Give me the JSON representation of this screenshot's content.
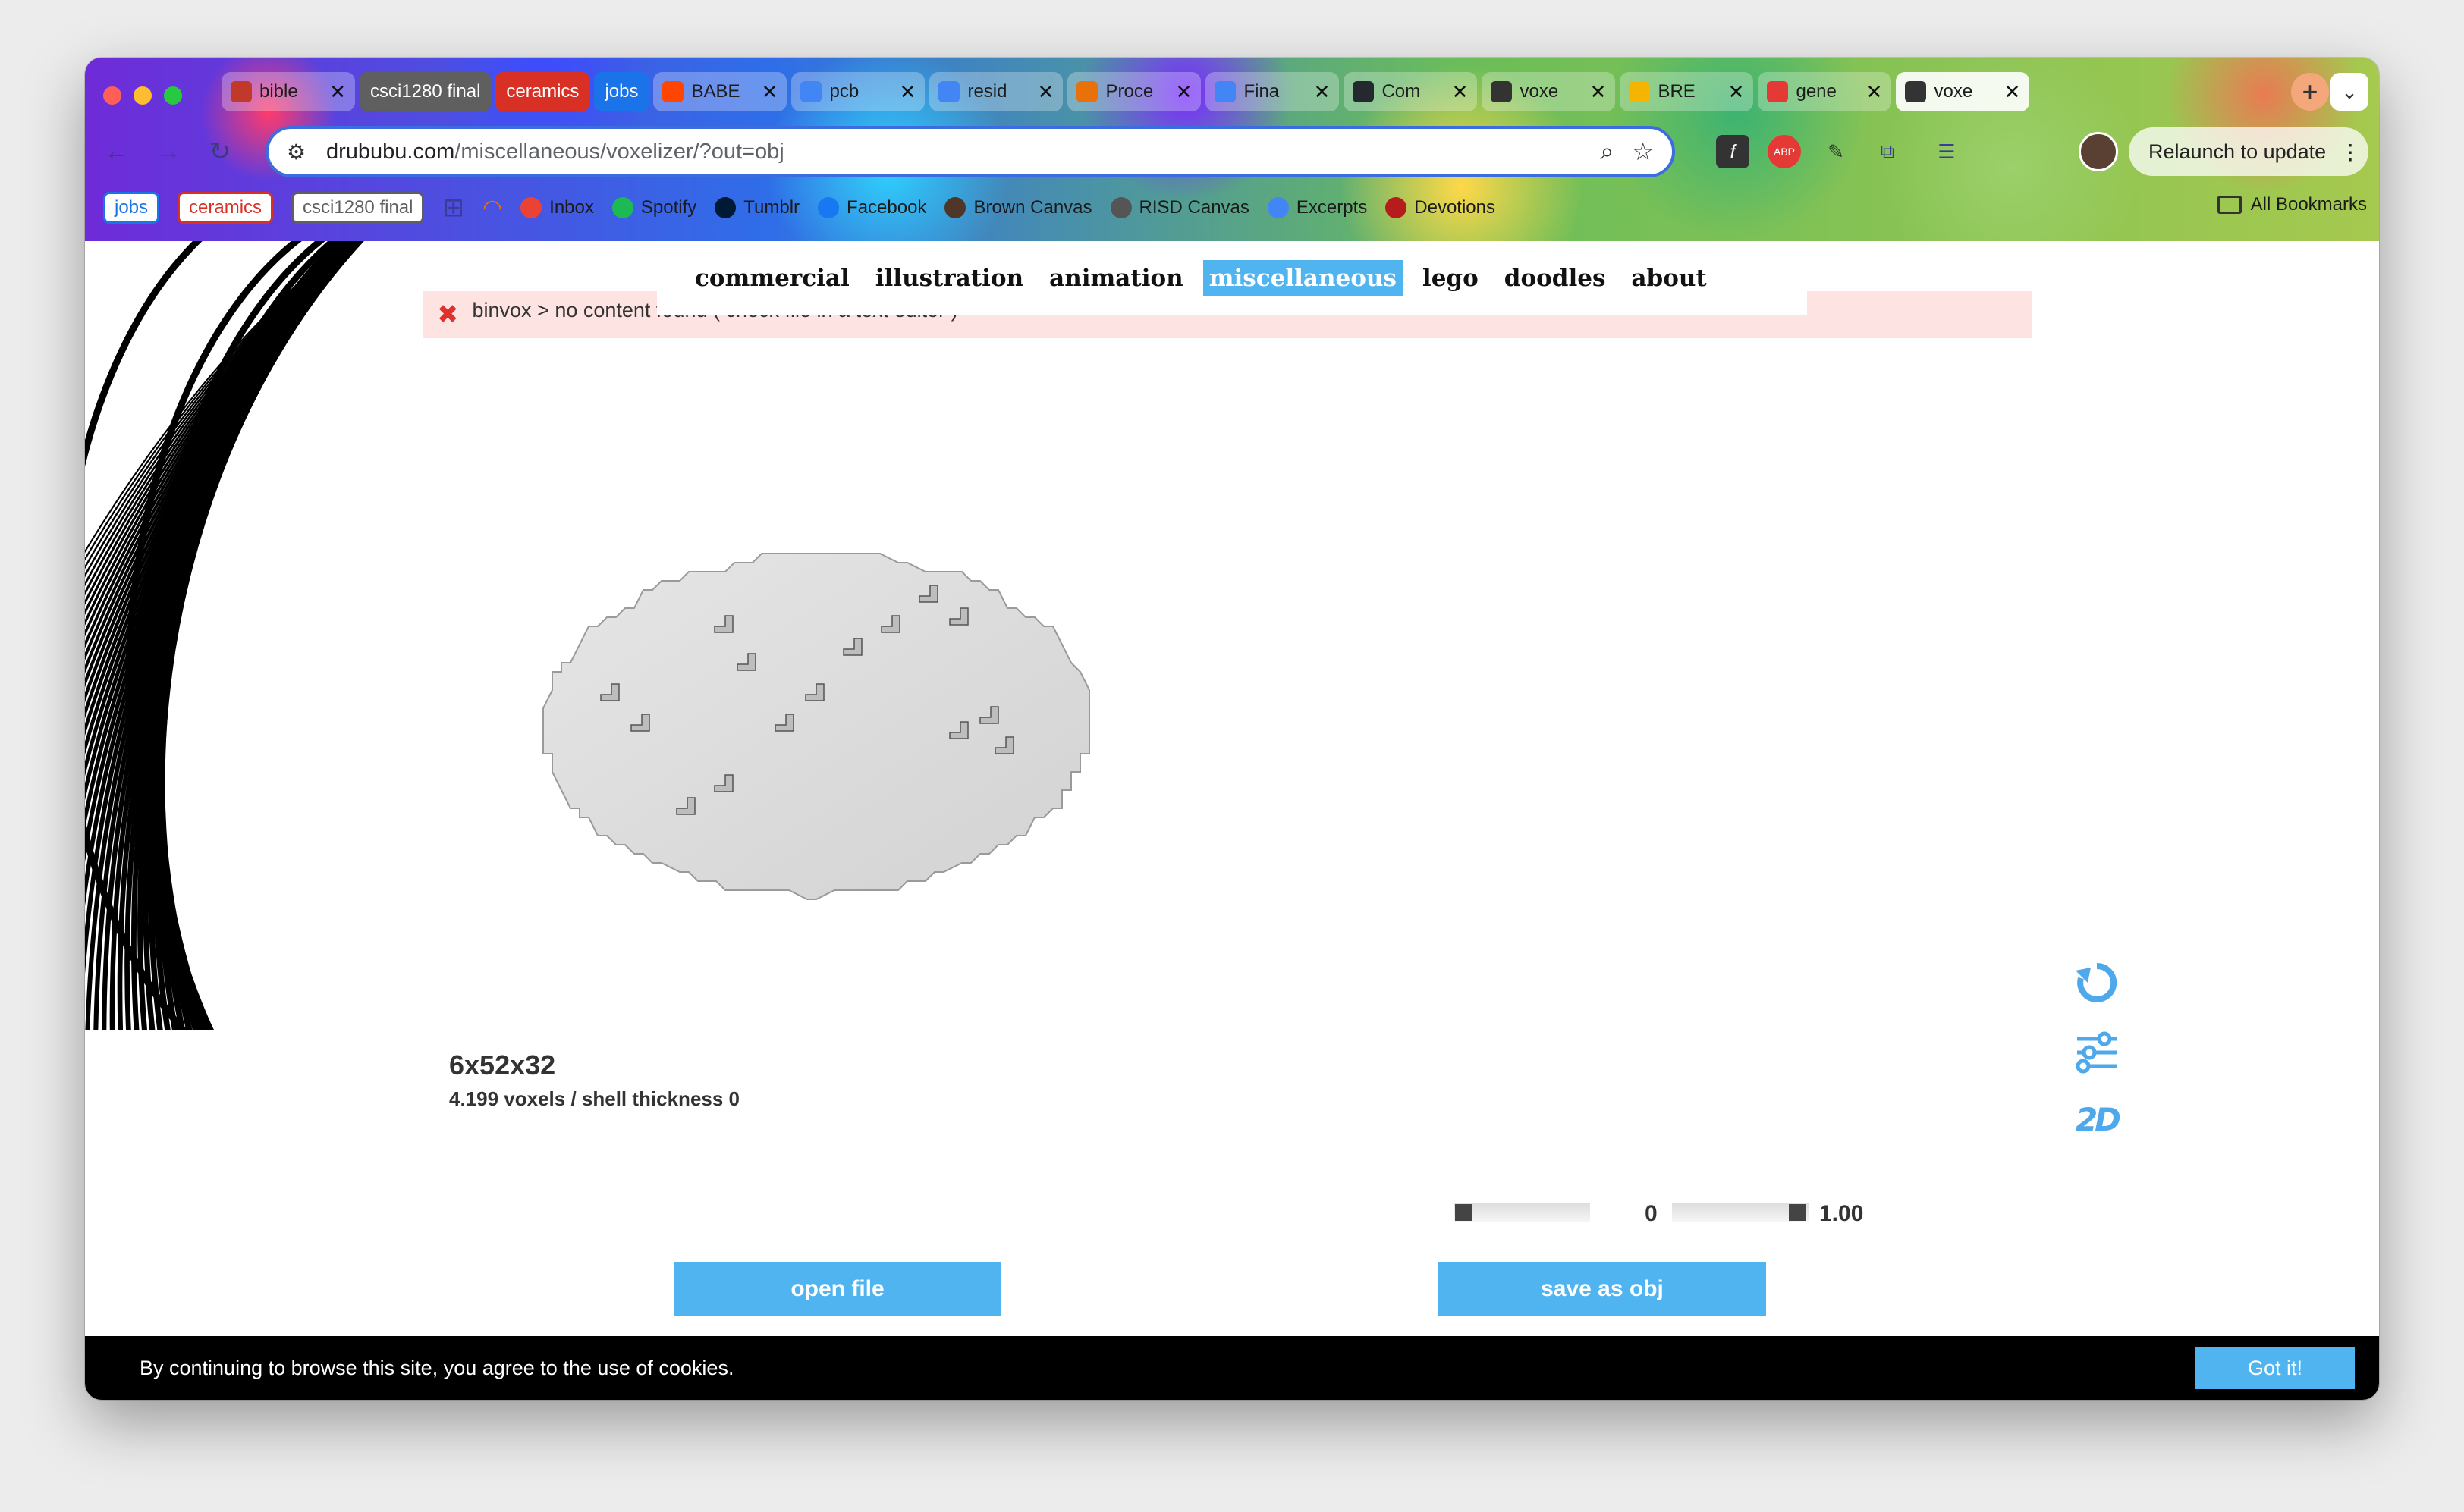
{
  "tabs": [
    {
      "title": "bible",
      "favicon_color": "#c0392b",
      "kind": "tab"
    },
    {
      "title": "csci1280 final",
      "kind": "group",
      "color": "#5f5f5f"
    },
    {
      "title": "ceramics",
      "kind": "group",
      "color": "#d93025"
    },
    {
      "title": "jobs",
      "kind": "group",
      "color": "#1a73e8"
    },
    {
      "title": "BABE",
      "favicon_color": "#ff4500",
      "kind": "tab"
    },
    {
      "title": "pcb",
      "favicon_color": "#4285f4",
      "kind": "tab"
    },
    {
      "title": "resid",
      "favicon_color": "#4285f4",
      "kind": "tab"
    },
    {
      "title": "Proce",
      "favicon_color": "#e8710a",
      "kind": "tab"
    },
    {
      "title": "Fina",
      "favicon_color": "#4285f4",
      "kind": "tab"
    },
    {
      "title": "Com",
      "favicon_color": "#24292f",
      "kind": "tab"
    },
    {
      "title": "voxe",
      "favicon_color": "#333333",
      "kind": "tab"
    },
    {
      "title": "BRE",
      "favicon_color": "#f4b400",
      "kind": "tab"
    },
    {
      "title": "gene",
      "favicon_color": "#e53935",
      "kind": "tab"
    },
    {
      "title": "voxe",
      "favicon_color": "#333333",
      "kind": "tab",
      "active": true
    }
  ],
  "address": {
    "domain": "drububu.com",
    "path": "/miscellaneous/voxelizer/?out=obj"
  },
  "relaunch_label": "Relaunch to update",
  "bookmarks": {
    "groups": [
      {
        "label": "jobs",
        "color": "#1a73e8"
      },
      {
        "label": "ceramics",
        "color": "#d93025"
      },
      {
        "label": "csci1280 final",
        "color": "#5f5f5f"
      }
    ],
    "items": [
      {
        "label": "Inbox",
        "icon": "gmail-icon",
        "color": "#ea4335"
      },
      {
        "label": "Spotify",
        "icon": "spotify-icon",
        "color": "#1db954"
      },
      {
        "label": "Tumblr",
        "icon": "tumblr-icon",
        "color": "#001935"
      },
      {
        "label": "Facebook",
        "icon": "facebook-icon",
        "color": "#1877f2"
      },
      {
        "label": "Brown Canvas",
        "icon": "shield-icon",
        "color": "#4e3629"
      },
      {
        "label": "RISD Canvas",
        "icon": "canvas-icon",
        "color": "#555555"
      },
      {
        "label": "Excerpts",
        "icon": "docs-icon",
        "color": "#4285f4"
      },
      {
        "label": "Devotions",
        "icon": "book-icon",
        "color": "#b71c1c"
      }
    ],
    "all_label": "All Bookmarks"
  },
  "site_nav": [
    "commercial",
    "illustration",
    "animation",
    "miscellaneous",
    "lego",
    "doodles",
    "about"
  ],
  "site_nav_selected": "miscellaneous",
  "error_message": "binvox > no content found ( check file in a text editor )",
  "model": {
    "dimensions": "6x52x32",
    "info": "4.199 voxels / shell thickness 0"
  },
  "sliders": {
    "left_value": "0",
    "right_value": "1.00"
  },
  "buttons": {
    "open": "open file",
    "save": "save as obj"
  },
  "cookie": {
    "message": "By continuing to browse this site, you agree to the use of cookies.",
    "accept": "Got it!"
  },
  "colors": {
    "accent": "#50b4f0",
    "error_bg": "#fde4e2"
  }
}
